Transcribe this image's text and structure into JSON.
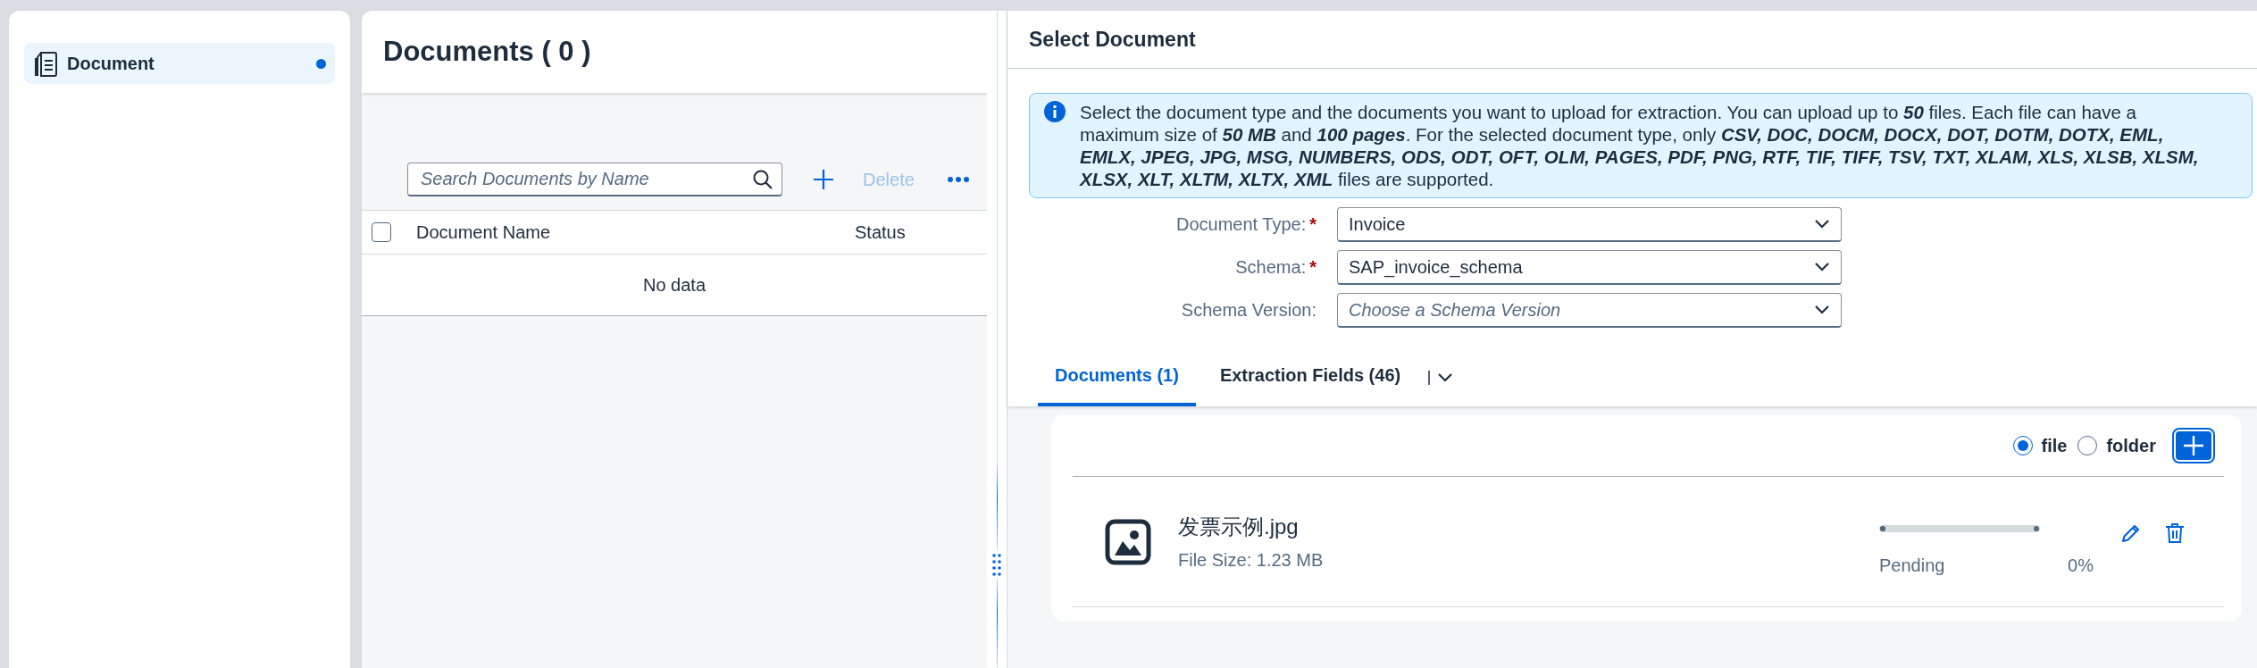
{
  "sidebar": {
    "items": [
      {
        "label": "Document",
        "selected": true,
        "indicator": true
      }
    ]
  },
  "documents_panel": {
    "title": "Documents ( 0 )",
    "search": {
      "placeholder": "Search Documents by Name"
    },
    "delete": {
      "label": "Delete",
      "disabled": true
    },
    "table": {
      "select_all": {
        "checked": false
      },
      "columns": [
        "Document Name",
        "Status"
      ],
      "empty_text": "No data"
    }
  },
  "select_panel": {
    "title": "Select Document",
    "info": "Select the document type and the documents you want to upload for extraction. You can upload up to **50** files. Each file can have a maximum size of **50 MB** and **100 pages**. For the selected document type, only **CSV, DOC, DOCM, DOCX, DOT, DOTM, DOTX, EML, EMLX, JPEG, JPG, MSG, NUMBERS, ODS, ODT, OFT, OLM, PAGES, PDF, PNG, RTF, TIF, TIFF, TSV, TXT, XLAM, XLS, XLSB, XLSM, XLSX, XLT, XLTM, XLTX, XML** files are supported.",
    "form": [
      {
        "label": "Document Type:",
        "required_mark": "*",
        "value": "Invoice"
      },
      {
        "label": "Schema:",
        "required_mark": "*",
        "value": "SAP_invoice_schema"
      },
      {
        "label": "Schema Version:",
        "placeholder": "Choose a Schema Version"
      }
    ],
    "tabs": [
      {
        "label": "Documents (1)",
        "selected": true
      },
      {
        "label": "Extraction Fields (46)",
        "selected": false
      }
    ],
    "upload_mode": [
      {
        "label": "file",
        "selected": true
      },
      {
        "label": "folder",
        "selected": false
      }
    ],
    "files": [
      {
        "name": "发票示例.jpg",
        "size": "File Size: 1.23 MB",
        "status": "Pending",
        "level": 0,
        "percent": "0%"
      }
    ]
  }
}
